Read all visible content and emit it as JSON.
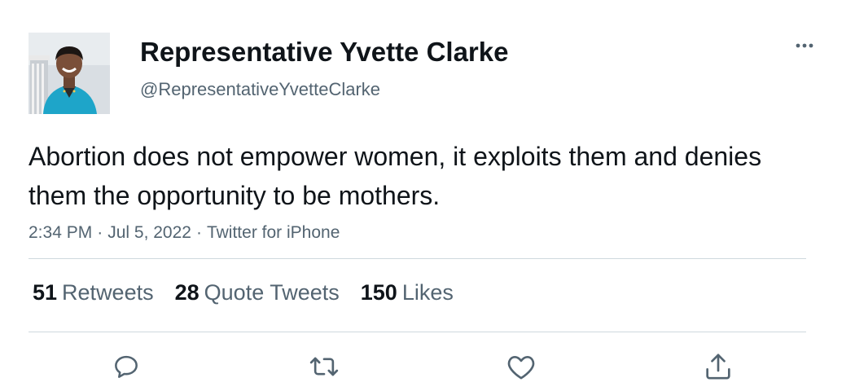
{
  "tweet": {
    "author": {
      "display_name": "Representative Yvette Clarke",
      "handle": "@RepresentativeYvetteClarke",
      "avatar_icon": "profile-photo"
    },
    "text": "Abortion does not empower women, it exploits them and denies them the opportunity to be mothers.",
    "time": "2:34 PM",
    "date": "Jul 5, 2022",
    "source": "Twitter for iPhone",
    "separator": "·",
    "stats": {
      "retweets": {
        "count": "51",
        "label": "Retweets"
      },
      "quote_tweets": {
        "count": "28",
        "label": "Quote Tweets"
      },
      "likes": {
        "count": "150",
        "label": "Likes"
      }
    },
    "actions": {
      "reply_icon": "reply-icon",
      "retweet_icon": "retweet-icon",
      "like_icon": "heart-icon",
      "share_icon": "share-icon"
    },
    "colors": {
      "primary_text": "#0f1419",
      "secondary_text": "#536471",
      "divider": "#cfd9de"
    }
  }
}
